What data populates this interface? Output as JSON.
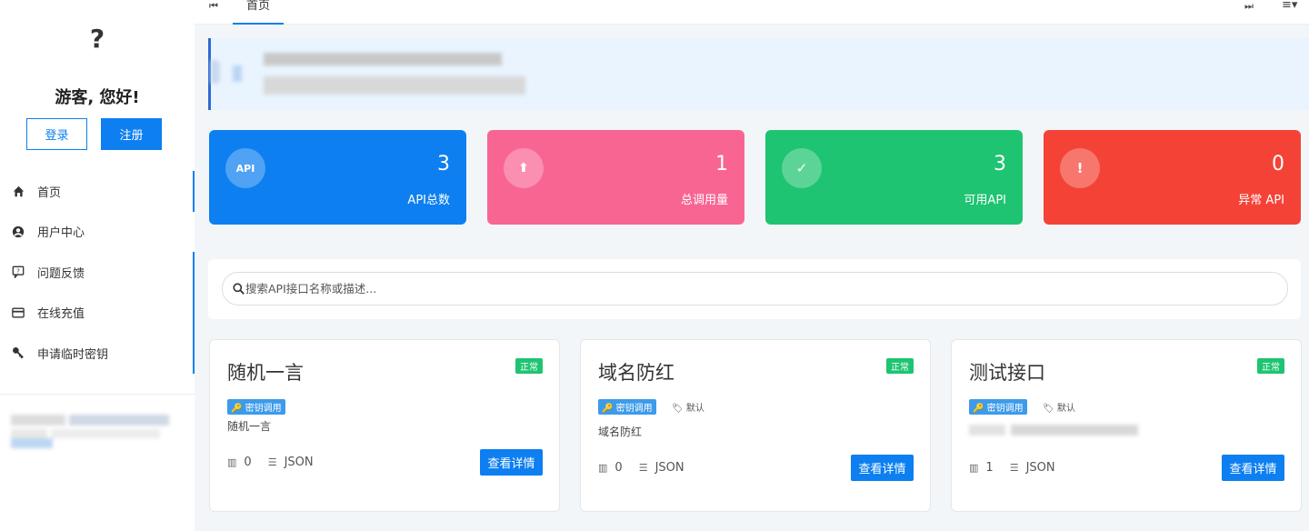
{
  "sidebar": {
    "avatar": "?",
    "greeting": "游客, 您好!",
    "login_label": "登录",
    "register_label": "注册",
    "items": [
      {
        "label": "首页",
        "icon": "home-icon"
      },
      {
        "label": "用户中心",
        "icon": "user-icon"
      },
      {
        "label": "问题反馈",
        "icon": "feedback-icon"
      },
      {
        "label": "在线充值",
        "icon": "credit-card-icon"
      },
      {
        "label": "申请临时密钥",
        "icon": "key-icon"
      }
    ]
  },
  "topbar": {
    "first_icon": "⏮",
    "tab_home": "首页",
    "last_icon": "⏭",
    "menu_icon": "≡▾"
  },
  "stats": [
    {
      "icon_text": "API",
      "value": "3",
      "label": "API总数",
      "color": "#0d7ff0"
    },
    {
      "icon_text": "⬆",
      "value": "1",
      "label": "总调用量",
      "color": "#f96593"
    },
    {
      "icon_text": "✓",
      "value": "3",
      "label": "可用API",
      "color": "#1ec471"
    },
    {
      "icon_text": "!",
      "value": "0",
      "label": "异常 API",
      "color": "#f44336"
    }
  ],
  "search": {
    "placeholder": "搜索API接口名称或描述..."
  },
  "apis": [
    {
      "title": "随机一言",
      "status": "正常",
      "tag_key": "🔑 密钥调用",
      "tag_default": "",
      "desc": "随机一言",
      "calls": "0",
      "format": "JSON",
      "button": "查看详情"
    },
    {
      "title": "域名防红",
      "status": "正常",
      "tag_key": "🔑 密钥调用",
      "tag_default": "默认",
      "desc": "域名防红",
      "calls": "0",
      "format": "JSON",
      "button": "查看详情"
    },
    {
      "title": "测试接口",
      "status": "正常",
      "tag_key": "🔑 密钥调用",
      "tag_default": "默认",
      "desc": "",
      "calls": "1",
      "format": "JSON",
      "button": "查看详情"
    }
  ]
}
